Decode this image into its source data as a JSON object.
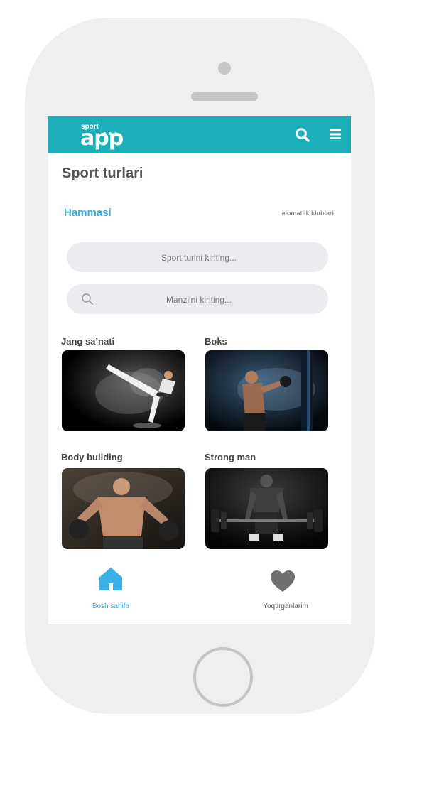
{
  "header": {
    "logo_small": "sport",
    "logo_big": "app",
    "search_icon": "search-icon",
    "menu_icon": "menu-icon",
    "bar_color": "#19aeb8"
  },
  "main": {
    "title": "Sport turlari",
    "tabs": [
      {
        "label": "Hammasi",
        "active": true
      },
      {
        "label": "alomatlik klublari",
        "active": false
      }
    ],
    "search_sport": {
      "placeholder": "Sport turini kiriting..."
    },
    "search_address": {
      "placeholder": "Manzilni kiriting...",
      "icon": "search-icon"
    },
    "categories": [
      {
        "label": "Jang sa’nati",
        "image": "karate-photo"
      },
      {
        "label": "Boks",
        "image": "boxing-photo"
      },
      {
        "label": "Body building",
        "image": "bodybuilding-photo"
      },
      {
        "label": "Strong man",
        "image": "strongman-photo"
      }
    ]
  },
  "bottom_nav": [
    {
      "label": "Bosh sahifa",
      "icon": "home-icon",
      "active": true
    },
    {
      "label": "Yoqtirganlarim",
      "icon": "heart-icon",
      "active": false
    }
  ],
  "colors": {
    "accent": "#2eaee4",
    "field_bg": "#ececf0"
  }
}
